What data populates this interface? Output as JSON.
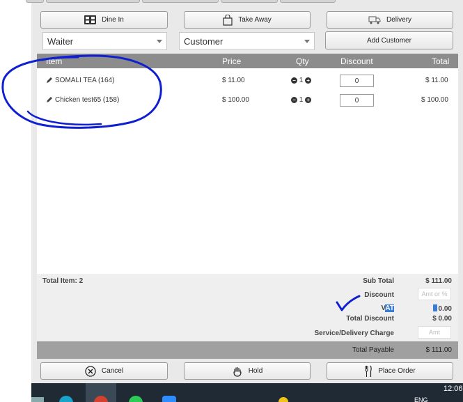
{
  "order_type_buttons": {
    "dine_in": "Dine In",
    "take_away": "Take Away",
    "delivery": "Delivery"
  },
  "selects": {
    "waiter": "Waiter",
    "customer": "Customer"
  },
  "add_customer": "Add Customer",
  "table": {
    "headers": {
      "item": "Item",
      "price": "Price",
      "qty": "Qty",
      "discount": "Discount",
      "total": "Total"
    },
    "rows": [
      {
        "name": "SOMALI TEA (164)",
        "price": "$ 11.00",
        "qty": "1",
        "discount": "0",
        "total": "$ 11.00"
      },
      {
        "name": "Chicken test65 (158)",
        "price": "$ 100.00",
        "qty": "1",
        "discount": "0",
        "total": "$ 100.00"
      }
    ]
  },
  "summary": {
    "total_item": "Total Item: 2",
    "sub_total_label": "Sub Total",
    "sub_total": "$ 111.00",
    "discount_label": "Discount",
    "discount_placeholder": "Amt or %",
    "vat_label_prefix": "V",
    "vat_label_highlight": "AT",
    "vat_value": "0.00",
    "total_discount_label": "Total Discount",
    "total_discount": "$ 0.00",
    "service_label": "Service/Delivery Charge",
    "service_placeholder": "Amt"
  },
  "total_payable_label": "Total Payable",
  "total_payable": "$ 111.00",
  "action_buttons": {
    "cancel": "Cancel",
    "hold": "Hold",
    "place_order": "Place Order"
  },
  "taskbar": {
    "clock": "12:06",
    "lang": "ENG"
  },
  "colors": {
    "header_gray": "#8c8c8c",
    "annotation_blue": "#1020d0",
    "vat_highlight": "#3a7bd5"
  }
}
